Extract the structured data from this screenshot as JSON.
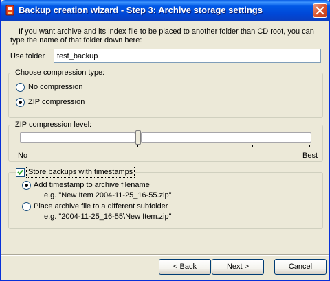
{
  "window": {
    "title": "Backup creation wizard - Step 3: Archive storage settings",
    "title_color": "#0058e6",
    "close_icon": "close-icon"
  },
  "intro": {
    "line1": "If you want archive and its index file to be placed to another folder than CD root, you can",
    "line2": "type the name of that folder down here:"
  },
  "folder": {
    "label": "Use folder",
    "value": "test_backup"
  },
  "compression_type": {
    "legend": "Choose compression type:",
    "options": [
      {
        "label": "No compression",
        "checked": false
      },
      {
        "label": "ZIP compression",
        "checked": true
      }
    ]
  },
  "compression_level": {
    "legend": "ZIP compression level:",
    "min_label": "No",
    "max_label": "Best",
    "level_fraction": 0.41,
    "tick_count": 6
  },
  "timestamps": {
    "checkbox_label": "Store backups with timestamps",
    "checked": true,
    "options": [
      {
        "label": "Add timestamp to archive filename",
        "example": "e.g. \"New Item 2004-11-25_16-55.zip\"",
        "checked": true
      },
      {
        "label": "Place archive file to a different subfolder",
        "example": "e.g. \"2004-11-25_16-55\\New Item.zip\"",
        "checked": false
      }
    ]
  },
  "buttons": {
    "back": "< Back",
    "next": "Next >",
    "cancel": "Cancel"
  }
}
